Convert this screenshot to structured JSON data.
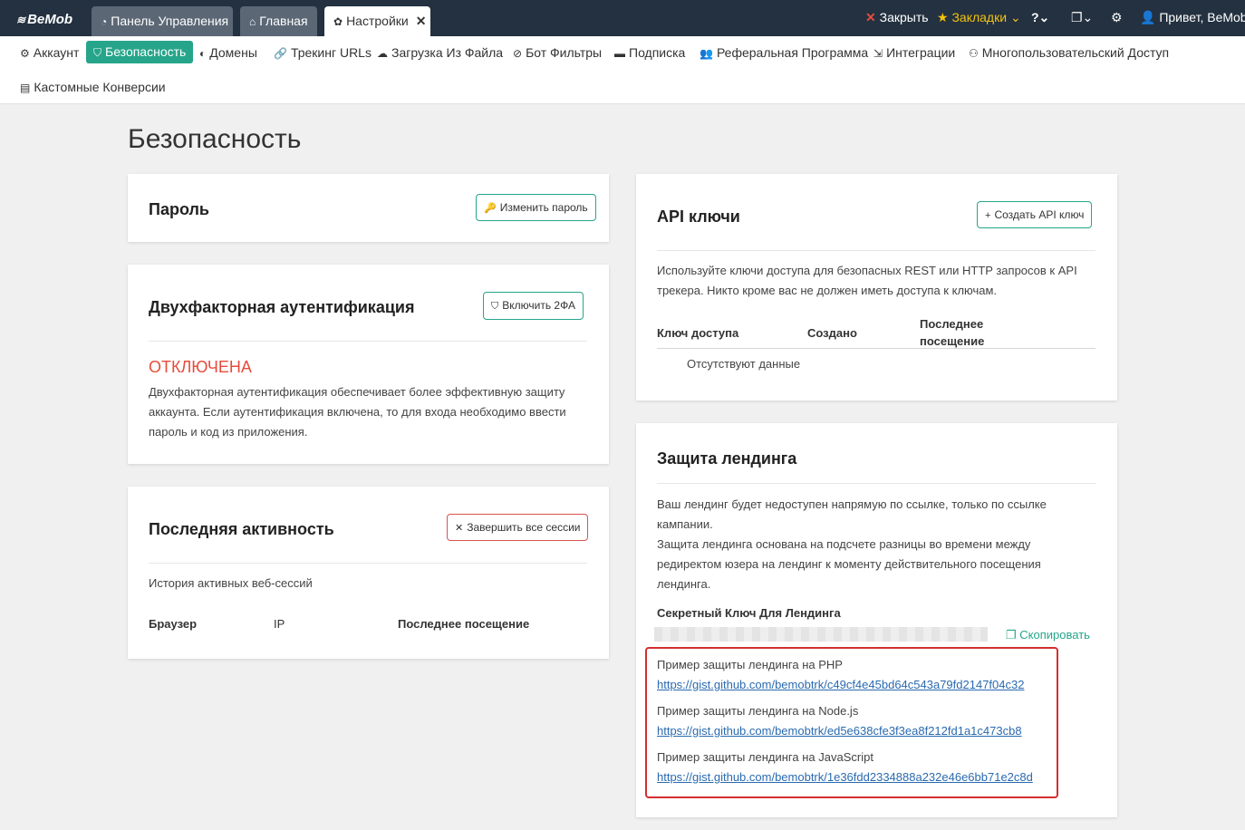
{
  "topbar": {
    "logo": "BeMob",
    "tabs": [
      {
        "label": "Панель Управления"
      },
      {
        "label": "Главная"
      },
      {
        "label": "Настройки"
      }
    ],
    "close_label": "Закрыть",
    "bookmarks_label": "Закладки",
    "greeting": "Привет, BeMob"
  },
  "subnav": {
    "items": [
      {
        "label": "Аккаунт"
      },
      {
        "label": "Безопасность"
      },
      {
        "label": "Домены"
      },
      {
        "label": "Трекинг URLs"
      },
      {
        "label": "Загрузка Из Файла"
      },
      {
        "label": "Бот Фильтры"
      },
      {
        "label": "Подписка"
      },
      {
        "label": "Реферальная Программа"
      },
      {
        "label": "Интеграции"
      },
      {
        "label": "Многопользовательский Доступ"
      },
      {
        "label": "Кастомные Конверсии"
      }
    ]
  },
  "page": {
    "title": "Безопасность"
  },
  "password": {
    "title": "Пароль",
    "button": "Изменить пароль"
  },
  "twofa": {
    "title": "Двухфакторная аутентификация",
    "button": "Включить 2ФА",
    "status": "ОТКЛЮЧЕНА",
    "desc_1": "Двухфакторная аутентификация обеспечивает более эффективную защиту",
    "desc_2": "аккаунта. Если аутентификация включена, то для входа необходимо ввести",
    "desc_3": "пароль и код из приложения."
  },
  "activity": {
    "title": "Последняя активность",
    "button": "Завершить все сессии",
    "subtitle": "История активных веб-сессий",
    "columns": [
      "Браузер",
      "IP",
      "Последнее посещение"
    ]
  },
  "api": {
    "title": "API ключи",
    "button": "Создать API ключ",
    "desc_1": "Используйте ключи доступа для безопасных REST или HTTP запросов к API",
    "desc_2": "трекера. Никто кроме вас не должен иметь доступа к ключам.",
    "columns": [
      "Ключ доступа",
      "Создано",
      "Последнее",
      "посещение"
    ],
    "empty": "Отсутствуют данные"
  },
  "landing": {
    "title": "Защита лендинга",
    "desc_1": "Ваш лендинг будет недоступен напрямую по ссылке, только по ссылке",
    "desc_2": "кампании.",
    "desc_3": "Защита лендинга основана на подсчете разницы во времени между",
    "desc_4": "редиректом юзера на лендинг к моменту действительного посещения",
    "desc_5": "лендинга.",
    "secret_label": "Секретный Ключ Для Лендинга",
    "copy_label": "Скопировать",
    "examples": [
      {
        "label": "Пример защиты лендинга на PHP",
        "url": "https://gist.github.com/bemobtrk/c49cf4e45bd64c543a79fd2147f04c32"
      },
      {
        "label": "Пример защиты лендинга на Node.js",
        "url": "https://gist.github.com/bemobtrk/ed5e638cfe3f3ea8f212fd1a1c473cb8"
      },
      {
        "label": "Пример защиты лендинга на JavaScript",
        "url": "https://gist.github.com/bemobtrk/1e36fdd2334888a232e46e6bb71e2c8d"
      }
    ]
  },
  "colors": {
    "accent": "#26a58b",
    "topbar": "#233140",
    "danger": "#e74c3c",
    "link": "#2a6ab0"
  }
}
